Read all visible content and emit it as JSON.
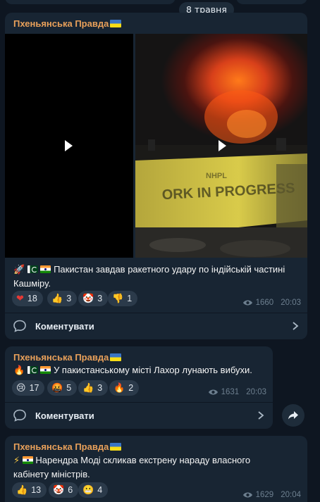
{
  "date_separator": "8 травня",
  "messages": [
    {
      "channel": "Пхеньянська Правда",
      "text": "Пакистан завдав ракетного удару по індійській частині Кашміру.",
      "reactions": [
        {
          "icon": "heart-icon",
          "glyph": "❤",
          "count": "18"
        },
        {
          "icon": "thumbs-up-icon",
          "glyph": "👍",
          "count": "3"
        },
        {
          "icon": "clown-icon",
          "glyph": "🤡",
          "count": "3"
        },
        {
          "icon": "thumbs-down-icon",
          "glyph": "👎",
          "count": "1"
        }
      ],
      "views": "1660",
      "time": "20:03",
      "comment_label": "Коментувати"
    },
    {
      "channel": "Пхеньянська Правда",
      "text": "У пакистанському місті Лахор лунають вибухи.",
      "reactions": [
        {
          "icon": "crying-face-icon",
          "glyph": "😢",
          "count": "17"
        },
        {
          "icon": "angry-face-icon",
          "glyph": "🤬",
          "count": "5"
        },
        {
          "icon": "thumbs-up-icon",
          "glyph": "👍",
          "count": "3"
        },
        {
          "icon": "fire-icon",
          "glyph": "🔥",
          "count": "2"
        }
      ],
      "views": "1631",
      "time": "20:03",
      "comment_label": "Коментувати"
    },
    {
      "channel": "Пхеньянська Правда",
      "text": "Нарендра Моді скликав екстрену нараду власного кабінету міністрів.",
      "reactions": [
        {
          "icon": "thumbs-up-icon",
          "glyph": "👍",
          "count": "13"
        },
        {
          "icon": "clown-icon",
          "glyph": "🤡",
          "count": "6"
        },
        {
          "icon": "grimacing-face-icon",
          "glyph": "😬",
          "count": "4"
        }
      ],
      "views": "1629",
      "time": "20:04"
    }
  ],
  "colors": {
    "background": "#0e1621",
    "bubble": "#182533",
    "channel_name": "#e8a05a",
    "meta": "#6d7f8f"
  }
}
